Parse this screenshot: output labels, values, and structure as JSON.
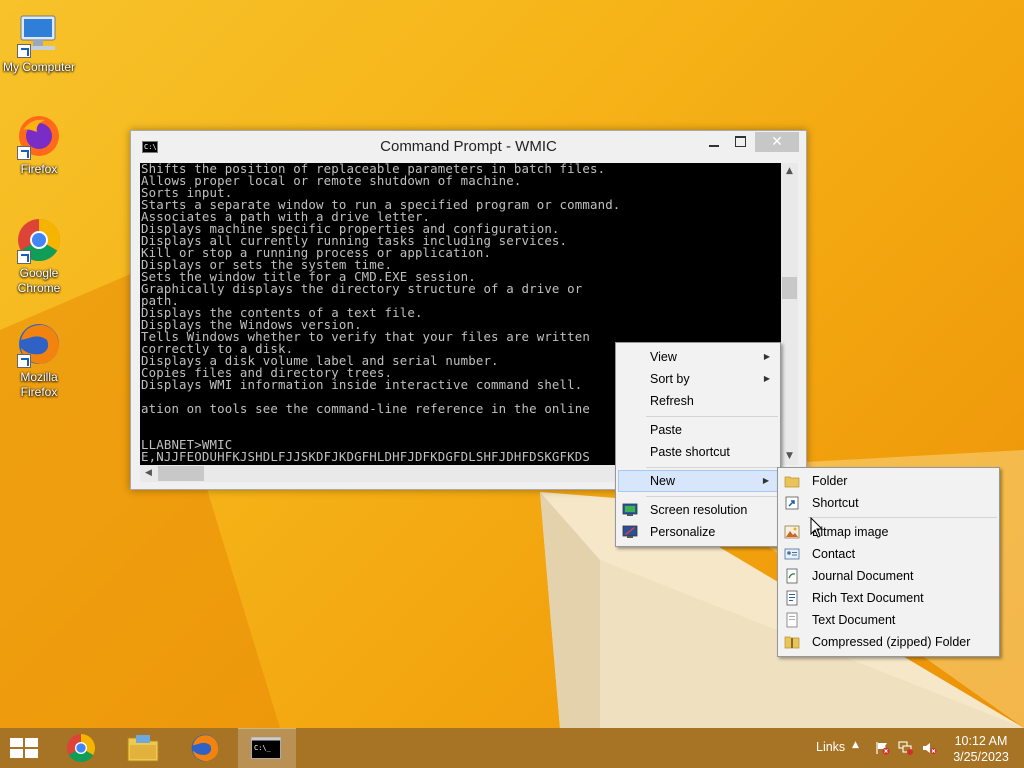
{
  "desktop": {
    "icons": [
      {
        "label": "My Computer",
        "icon": "computer-icon"
      },
      {
        "label": "Firefox",
        "icon": "firefox-icon"
      },
      {
        "label": "Google Chrome",
        "icon": "chrome-icon"
      },
      {
        "label": "Mozilla Firefox",
        "icon": "firefox-icon"
      }
    ]
  },
  "cmd": {
    "title": "Command Prompt - WMIC",
    "close_glyph": "✕",
    "lines": [
      "Shifts the position of replaceable parameters in batch files.",
      "Allows proper local or remote shutdown of machine.",
      "Sorts input.",
      "Starts a separate window to run a specified program or command.",
      "Associates a path with a drive letter.",
      "Displays machine specific properties and configuration.",
      "Displays all currently running tasks including services.",
      "Kill or stop a running process or application.",
      "Displays or sets the system time.",
      "Sets the window title for a CMD.EXE session.",
      "Graphically displays the directory structure of a drive or",
      "path.",
      "Displays the contents of a text file.",
      "Displays the Windows version.",
      "Tells Windows whether to verify that your files are written",
      "correctly to a disk.",
      "Displays a disk volume label and serial number.",
      "Copies files and directory trees.",
      "Displays WMI information inside interactive command shell.",
      "",
      "ation on tools see the command-line reference in the online",
      "",
      "",
      "LLABNET>WMIC",
      "E,NJJFEODUHFKJSHDLFJJSKDFJKDGFHLDHFJDFKDGFDLSHFJDHFDSKGFKDS"
    ]
  },
  "context_menu": {
    "items": [
      {
        "label": "View",
        "submenu": true
      },
      {
        "label": "Sort by",
        "submenu": true
      },
      {
        "label": "Refresh"
      },
      {
        "label": "Paste"
      },
      {
        "label": "Paste shortcut"
      },
      {
        "label": "New",
        "submenu": true,
        "highlighted": true
      },
      {
        "label": "Screen resolution",
        "icon": "screen-resolution-icon"
      },
      {
        "label": "Personalize",
        "icon": "personalize-icon"
      }
    ],
    "submenu_glyph": "▶"
  },
  "new_menu": {
    "items": [
      {
        "label": "Folder",
        "icon": "folder-icon"
      },
      {
        "label": "Shortcut",
        "icon": "shortcut-icon"
      },
      {
        "label": "Bitmap image",
        "icon": "bitmap-icon"
      },
      {
        "label": "Contact",
        "icon": "contact-icon"
      },
      {
        "label": "Journal Document",
        "icon": "journal-icon"
      },
      {
        "label": "Rich Text Document",
        "icon": "rich-text-icon"
      },
      {
        "label": "Text Document",
        "icon": "text-document-icon"
      },
      {
        "label": "Compressed (zipped) Folder",
        "icon": "zip-folder-icon"
      }
    ]
  },
  "taskbar": {
    "apps": [
      {
        "name": "chrome",
        "icon": "chrome-icon"
      },
      {
        "name": "file-explorer",
        "icon": "file-explorer-icon"
      },
      {
        "name": "firefox",
        "icon": "firefox-icon"
      },
      {
        "name": "command-prompt",
        "icon": "cmd-icon",
        "active": true
      }
    ],
    "links_label": "Links",
    "tray_up_glyph": "▲",
    "clock_time": "10:12 AM",
    "clock_date": "3/25/2023"
  },
  "colors": {
    "desktop_bg": "#f6b519",
    "console_bg": "#000000",
    "console_fg": "#c0c0c0",
    "menu_highlight": "#d7e6fb",
    "taskbar": "#a77324"
  }
}
